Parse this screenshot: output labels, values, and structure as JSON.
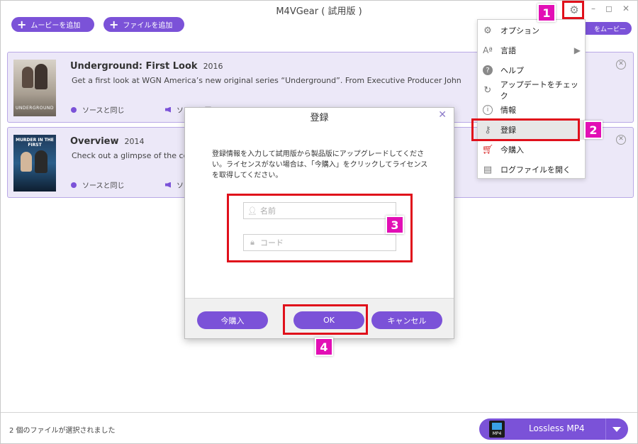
{
  "app": {
    "title": "M4VGear ( 試用版 )"
  },
  "window_controls": {
    "minimize": "–",
    "maximize": "◻",
    "close": "✕"
  },
  "toolbar": {
    "add_movie": "ムービーを追加",
    "add_file": "ファイルを追加",
    "behind_menu_button": "をムービー"
  },
  "items": [
    {
      "title": "Underground: First Look",
      "year": "2016",
      "description": "Get a first look at WGN America’s new original series “Underground”. From Executive Producer John",
      "video": "ソースと同じ",
      "audio": "ソースと同",
      "thumb_text": "UNDERGROUND"
    },
    {
      "title": "Overview",
      "year": "2014",
      "description": "Check out a glimpse of the compl",
      "video": "ソースと同じ",
      "audio": "ソー",
      "thumb_text": "MURDER IN THE FIRST"
    }
  ],
  "settings_menu": {
    "items": [
      {
        "label": "オプション",
        "icon": "gear-icon"
      },
      {
        "label": "言語",
        "icon": "font-icon"
      },
      {
        "label": "ヘルプ",
        "icon": "help-icon"
      },
      {
        "label": "アップデートをチェック",
        "icon": "refresh-icon"
      },
      {
        "label": "情報",
        "icon": "info-icon"
      },
      {
        "label": "登録",
        "icon": "key-icon"
      },
      {
        "label": "今購入",
        "icon": "cart-icon"
      },
      {
        "label": "ログファイルを開く",
        "icon": "log-file-icon"
      }
    ]
  },
  "dialog": {
    "title": "登録",
    "message": "登録情報を入力して試用版から製品版にアップグレードしてください。ライセンスがない場合は、「今購入」をクリックしてライセンスを取得してください。",
    "name_placeholder": "名前",
    "code_placeholder": "コード",
    "buy_button": "今購入",
    "ok_button": "OK",
    "cancel_button": "キャンセル"
  },
  "annotations": {
    "step1": "1",
    "step2": "2",
    "step3": "3",
    "step4": "4",
    "color": "#e0101b",
    "badge_color": "#e20fb5"
  },
  "status": {
    "selected_text": "2 個のファイルが選択されました"
  },
  "output_format": {
    "label": "Lossless MP4",
    "icon_text": "MP4"
  },
  "colors": {
    "accent": "#7b52d8",
    "card_bg": "#ece8f8"
  }
}
